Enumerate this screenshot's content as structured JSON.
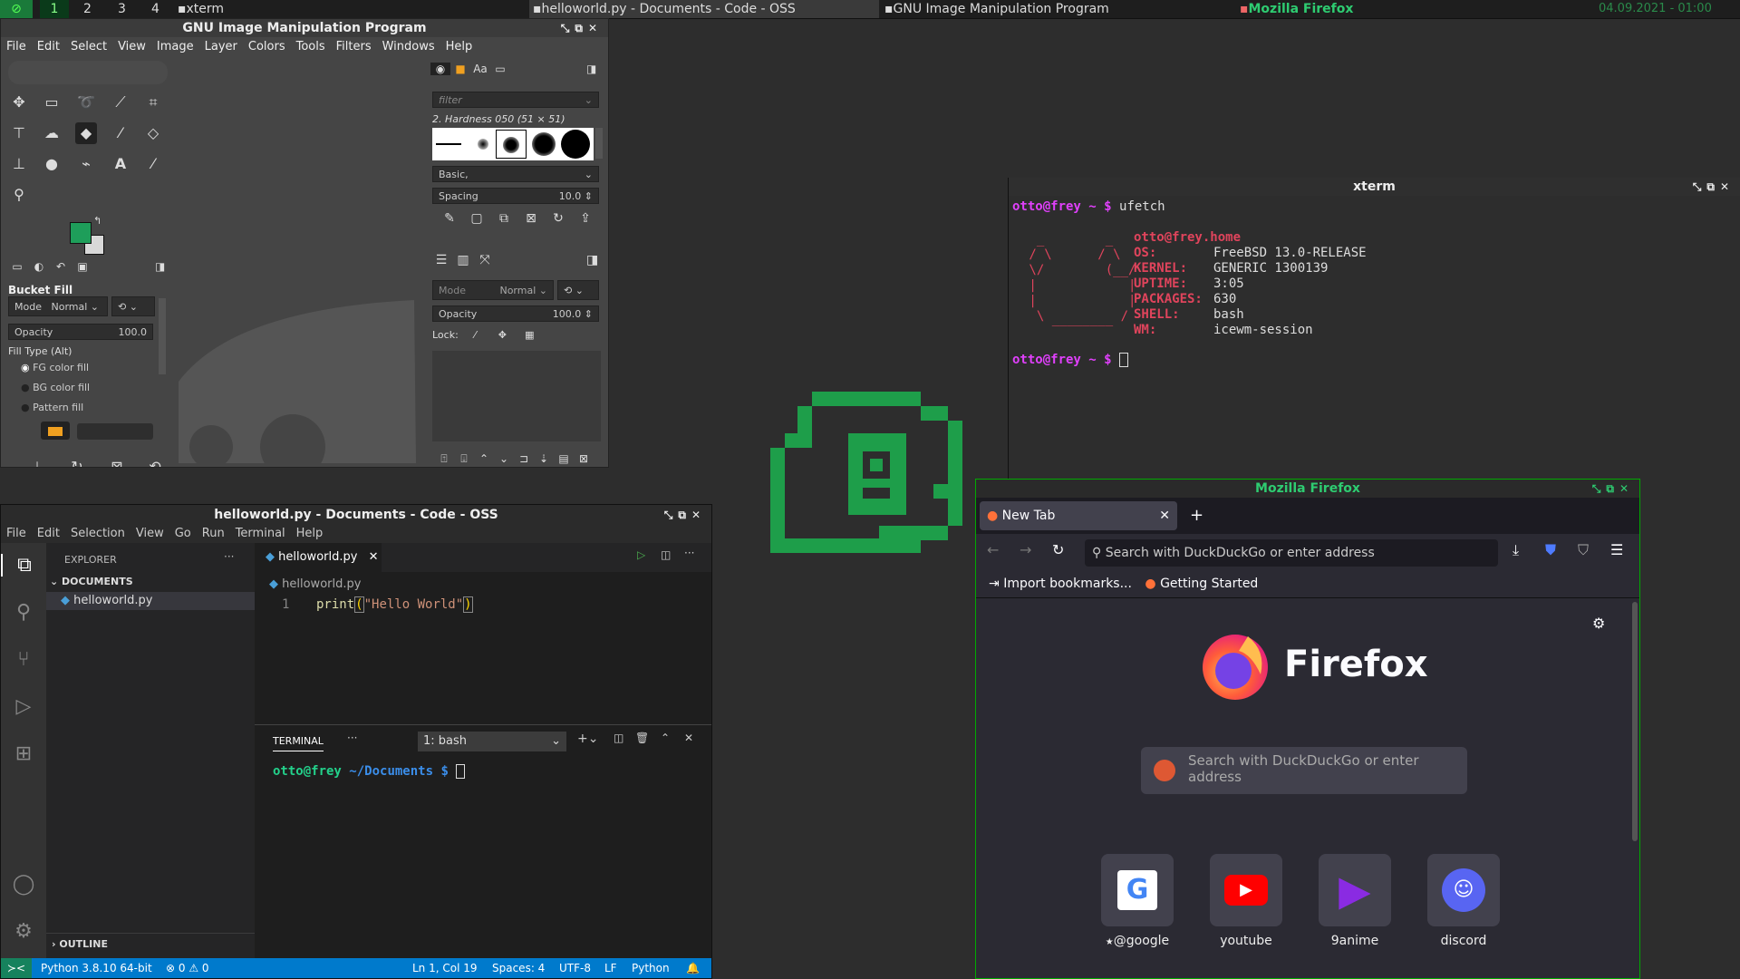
{
  "taskbar": {
    "workspaces": [
      "1",
      "2",
      "3",
      "4"
    ],
    "tasks": [
      "xterm",
      "helloworld.py - Documents - Code - OSS",
      "GNU Image Manipulation Program",
      "Mozilla Firefox"
    ],
    "clock": "04.09.2021 - 01:00"
  },
  "gimp": {
    "title": "GNU Image Manipulation Program",
    "menu": [
      "File",
      "Edit",
      "Select",
      "View",
      "Image",
      "Layer",
      "Colors",
      "Tools",
      "Filters",
      "Windows",
      "Help"
    ],
    "fg_color": "#1e9e5a",
    "bg_color": "#d8d8d8",
    "tool_options": {
      "title": "Bucket Fill",
      "mode_label": "Mode",
      "mode_value": "Normal",
      "opacity_label": "Opacity",
      "opacity_value": "100.0",
      "fill_type_label": "Fill Type  (Alt)",
      "fill_options": [
        "FG color fill",
        "BG color fill",
        "Pattern fill"
      ]
    },
    "brushes": {
      "filter_placeholder": "filter",
      "brush_name": "2. Hardness 050 (51 × 51)",
      "preset": "Basic,",
      "spacing_label": "Spacing",
      "spacing_value": "10.0"
    },
    "layers": {
      "mode_label": "Mode",
      "mode_value": "Normal",
      "opacity_label": "Opacity",
      "opacity_value": "100.0",
      "lock_label": "Lock:"
    }
  },
  "xterm": {
    "title": "xterm",
    "prompt": "otto@frey ~ $",
    "command": "ufetch",
    "user_host": "otto@frey.home",
    "info": [
      {
        "key": "OS:",
        "value": "FreeBSD 13.0-RELEASE"
      },
      {
        "key": "KERNEL:",
        "value": "GENERIC 1300139"
      },
      {
        "key": "UPTIME:",
        "value": "3:05"
      },
      {
        "key": "PACKAGES:",
        "value": "630"
      },
      {
        "key": "SHELL:",
        "value": "bash"
      },
      {
        "key": "WM:",
        "value": "icewm-session"
      }
    ],
    "accent_color": "#e0445c",
    "prompt_color": "#e040fb"
  },
  "code": {
    "title": "helloworld.py - Documents - Code - OSS",
    "menu": [
      "File",
      "Edit",
      "Selection",
      "View",
      "Go",
      "Run",
      "Terminal",
      "Help"
    ],
    "explorer_label": "EXPLORER",
    "folder_label": "DOCUMENTS",
    "file": "helloworld.py",
    "tab": "helloworld.py",
    "breadcrumb": "helloworld.py",
    "line_number": "1",
    "code_fn": "print",
    "code_open": "(",
    "code_string": "\"Hello World\"",
    "code_close": ")",
    "terminal_label": "TERMINAL",
    "terminal_select": "1: bash",
    "terminal_prompt_user": "otto@frey",
    "terminal_prompt_path": "~/Documents",
    "terminal_prompt_sym": "$",
    "outline_label": "OUTLINE",
    "status": {
      "python": "Python 3.8.10 64-bit",
      "problems": "⊗ 0 ⚠ 0",
      "position": "Ln 1, Col 19",
      "spaces": "Spaces: 4",
      "encoding": "UTF-8",
      "eol": "LF",
      "language": "Python"
    },
    "status_color": "#007acc"
  },
  "firefox": {
    "title": "Mozilla Firefox",
    "tab": "New Tab",
    "address_placeholder": "Search with DuckDuckGo or enter address",
    "bookmarks": [
      "Import bookmarks...",
      "Getting Started"
    ],
    "brand": "Firefox",
    "search_placeholder": "Search with DuckDuckGo or enter address",
    "shortcuts": [
      "@google",
      "youtube",
      "9anime",
      "discord"
    ]
  },
  "desktop_logo_color": "#1e9e4a"
}
